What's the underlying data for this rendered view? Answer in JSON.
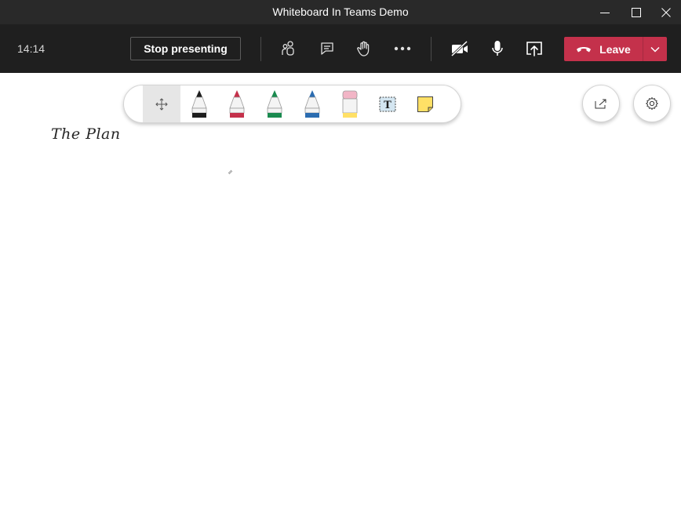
{
  "window": {
    "title": "Whiteboard In Teams Demo"
  },
  "meeting_bar": {
    "time": "14:14",
    "stop_presenting_label": "Stop presenting",
    "leave_label": "Leave"
  },
  "toolbar": {
    "tools": [
      {
        "name": "move-tool",
        "icon": "move-arrows-icon",
        "selected": true
      },
      {
        "name": "pen-black",
        "icon": "pen-icon",
        "color": "#1e1e1e"
      },
      {
        "name": "pen-red",
        "icon": "pen-icon",
        "color": "#c4314b"
      },
      {
        "name": "pen-green",
        "icon": "pen-icon",
        "color": "#1a8a4f"
      },
      {
        "name": "pen-blue",
        "icon": "pen-icon",
        "color": "#2b6cb0"
      },
      {
        "name": "eraser",
        "icon": "eraser-icon"
      },
      {
        "name": "text-tool",
        "icon": "text-box-icon"
      },
      {
        "name": "sticky-note",
        "icon": "sticky-note-icon"
      }
    ]
  },
  "canvas": {
    "text": "The Plan"
  },
  "colors": {
    "title_bar": "#292929",
    "meeting_bar": "#1f1f1f",
    "leave_button": "#c4314b",
    "sticky_note": "#ffe066",
    "eraser_pink": "#f2b5c6",
    "eraser_yellow": "#ffe066"
  }
}
